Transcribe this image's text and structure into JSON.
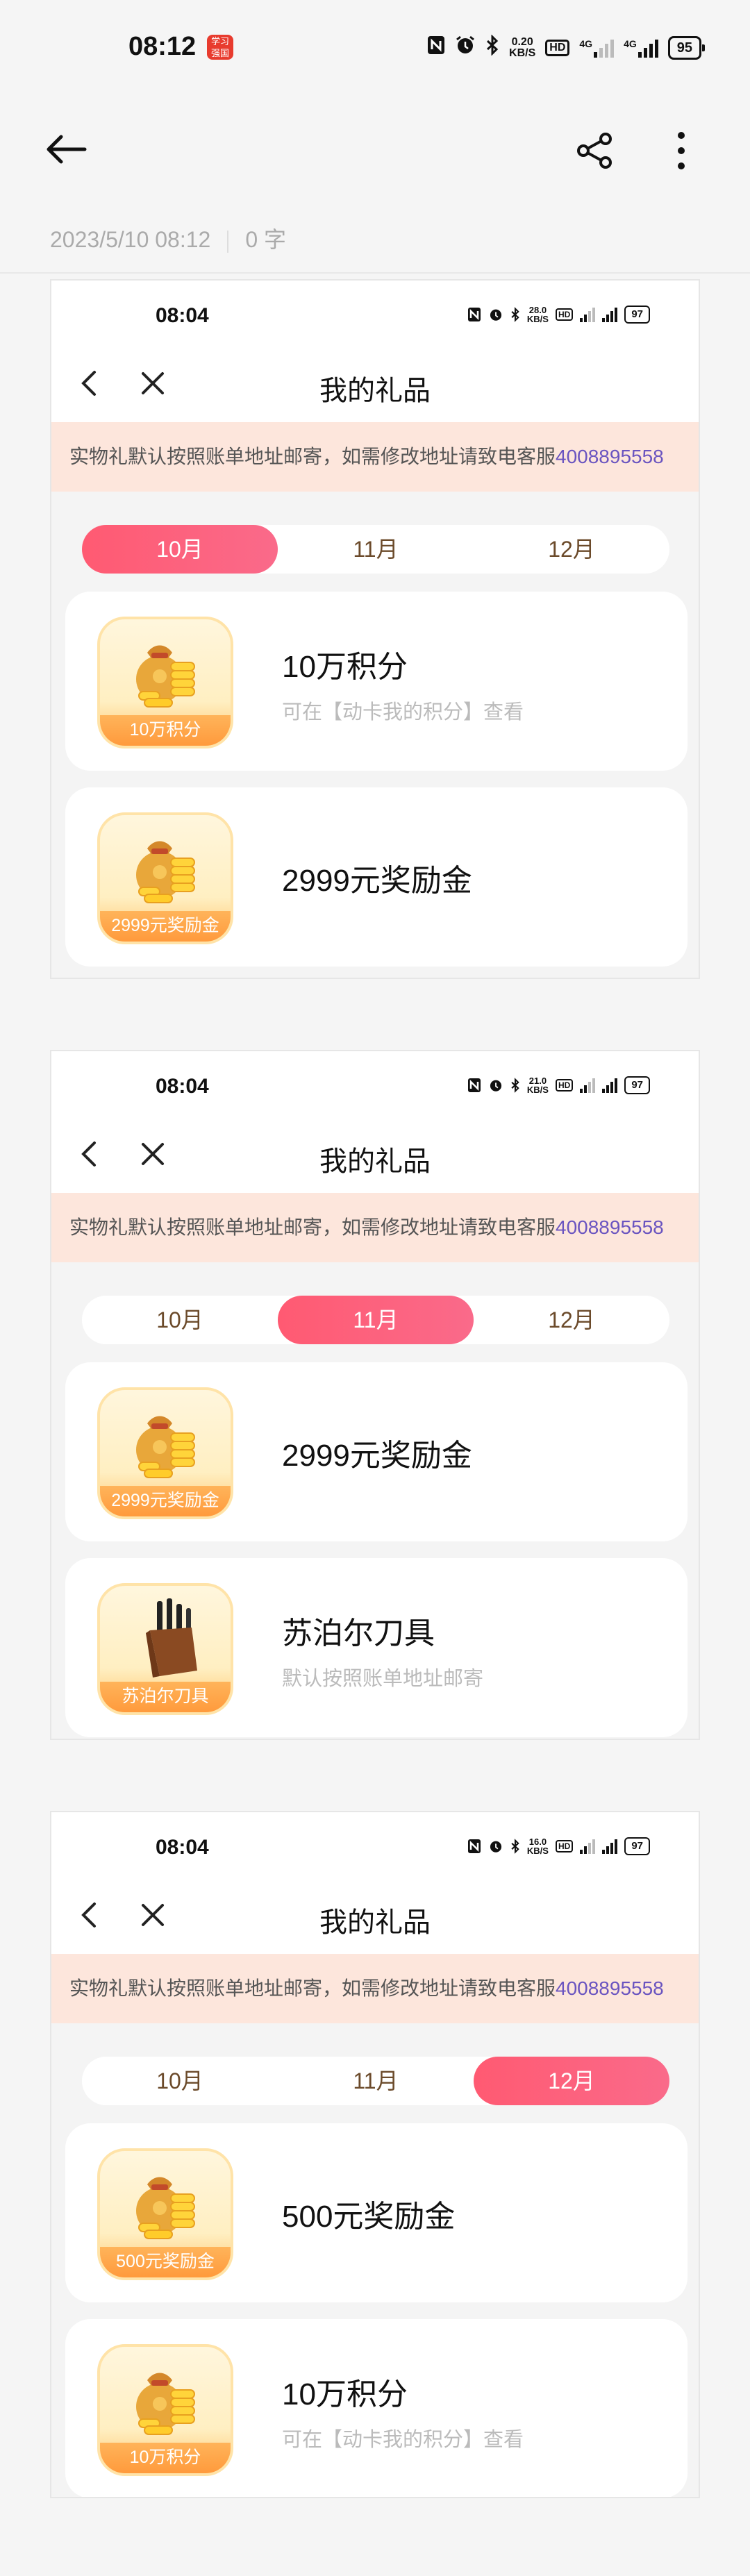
{
  "status_bar": {
    "time": "08:12",
    "app_badge": "学习\n强国",
    "speed": "0.20\nKB/S",
    "hd": "HD",
    "net1": "4G",
    "net2": "4G",
    "battery": "95"
  },
  "meta": {
    "date": "2023/5/10 08:12",
    "count": "0 字"
  },
  "shots": [
    {
      "status": {
        "time": "08:04",
        "speed": "28.0\nKB/S",
        "battery": "97"
      },
      "title": "我的礼品",
      "notice_text": "实物礼默认按照账单地址邮寄，如需修改地址请致电客服",
      "notice_phone": "4008895558",
      "tabs": [
        "10月",
        "11月",
        "12月"
      ],
      "active_tab": 0,
      "gifts": [
        {
          "name": "10万积分",
          "caption": "10万积分",
          "sub": "可在【动卡我的积分】查看",
          "icon": "coin-bag-icon"
        },
        {
          "name": "2999元奖励金",
          "caption": "2999元奖励金",
          "sub": "",
          "icon": "coin-bag-icon"
        }
      ]
    },
    {
      "status": {
        "time": "08:04",
        "speed": "21.0\nKB/S",
        "battery": "97"
      },
      "title": "我的礼品",
      "notice_text": "实物礼默认按照账单地址邮寄，如需修改地址请致电客服",
      "notice_phone": "4008895558",
      "tabs": [
        "10月",
        "11月",
        "12月"
      ],
      "active_tab": 1,
      "gifts": [
        {
          "name": "2999元奖励金",
          "caption": "2999元奖励金",
          "sub": "",
          "icon": "coin-bag-icon"
        },
        {
          "name": "苏泊尔刀具",
          "caption": "苏泊尔刀具",
          "sub": "默认按照账单地址邮寄",
          "icon": "knife-block-icon"
        }
      ]
    },
    {
      "status": {
        "time": "08:04",
        "speed": "16.0\nKB/S",
        "battery": "97"
      },
      "title": "我的礼品",
      "notice_text": "实物礼默认按照账单地址邮寄，如需修改地址请致电客服",
      "notice_phone": "4008895558",
      "tabs": [
        "10月",
        "11月",
        "12月"
      ],
      "active_tab": 2,
      "gifts": [
        {
          "name": "500元奖励金",
          "caption": "500元奖励金",
          "sub": "",
          "icon": "coin-bag-icon"
        },
        {
          "name": "10万积分",
          "caption": "10万积分",
          "sub": "可在【动卡我的积分】查看",
          "icon": "coin-bag-icon"
        }
      ]
    }
  ]
}
